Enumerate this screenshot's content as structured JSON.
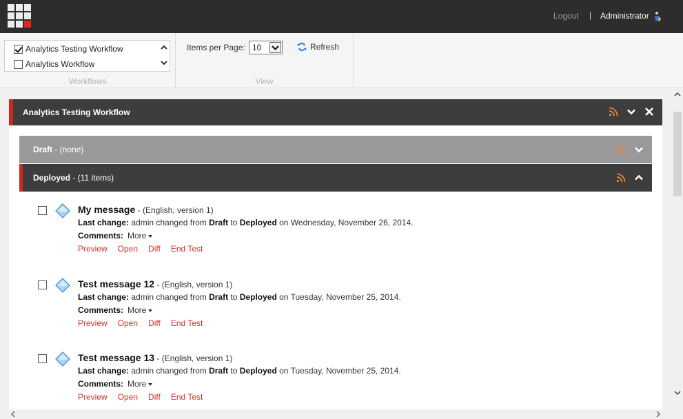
{
  "topbar": {
    "logout": "Logout",
    "separator": "|",
    "user": "Administrator"
  },
  "ribbon": {
    "workflows": {
      "caption": "Workflows",
      "items": [
        {
          "label": "Analytics Testing Workflow",
          "checked": true
        },
        {
          "label": "Analytics Workflow",
          "checked": false
        }
      ]
    },
    "view": {
      "caption": "View",
      "items_per_page_label": "Items per Page:",
      "items_per_page_value": "10",
      "refresh_label": "Refresh"
    }
  },
  "panel": {
    "title": "Analytics Testing Workflow",
    "stages": [
      {
        "name": "Draft",
        "detail": " - (none)",
        "expanded": false
      },
      {
        "name": "Deployed",
        "detail": " - (11 items)",
        "expanded": true
      }
    ],
    "labels": {
      "last_change": "Last change:",
      "comments": "Comments:",
      "more": "More"
    },
    "items": [
      {
        "name": "My message",
        "meta": " - (English, version 1)",
        "changed_by": " admin changed from ",
        "from": "Draft",
        "to_word": " to ",
        "to": "Deployed",
        "date": " on Wednesday, November 26, 2014.",
        "actions": [
          "Preview",
          "Open",
          "Diff",
          "End Test"
        ]
      },
      {
        "name": "Test message 12",
        "meta": " - (English, version 1)",
        "changed_by": " admin changed from ",
        "from": "Draft",
        "to_word": " to ",
        "to": "Deployed",
        "date": " on Tuesday, November 25, 2014.",
        "actions": [
          "Preview",
          "Open",
          "Diff",
          "End Test"
        ]
      },
      {
        "name": "Test message 13",
        "meta": " - (English, version 1)",
        "changed_by": " admin changed from ",
        "from": "Draft",
        "to_word": " to ",
        "to": "Deployed",
        "date": " on Tuesday, November 25, 2014.",
        "actions": [
          "Preview",
          "Open",
          "Diff",
          "End Test"
        ]
      }
    ]
  },
  "colors": {
    "accent": "#d0261f",
    "header_bg": "#3d3d3d",
    "draft_bg": "#999999",
    "rss": "#e8843a",
    "link_red": "#d3302a",
    "topbar": "#2d2d2d"
  },
  "icons": [
    "app-grid-icon",
    "user-icon",
    "rss-icon",
    "chevron-down-icon",
    "chevron-up-icon",
    "close-icon",
    "refresh-icon",
    "workflow-item-icon",
    "scroll-up-icon",
    "scroll-down-icon",
    "scroll-left-icon",
    "scroll-right-icon"
  ]
}
